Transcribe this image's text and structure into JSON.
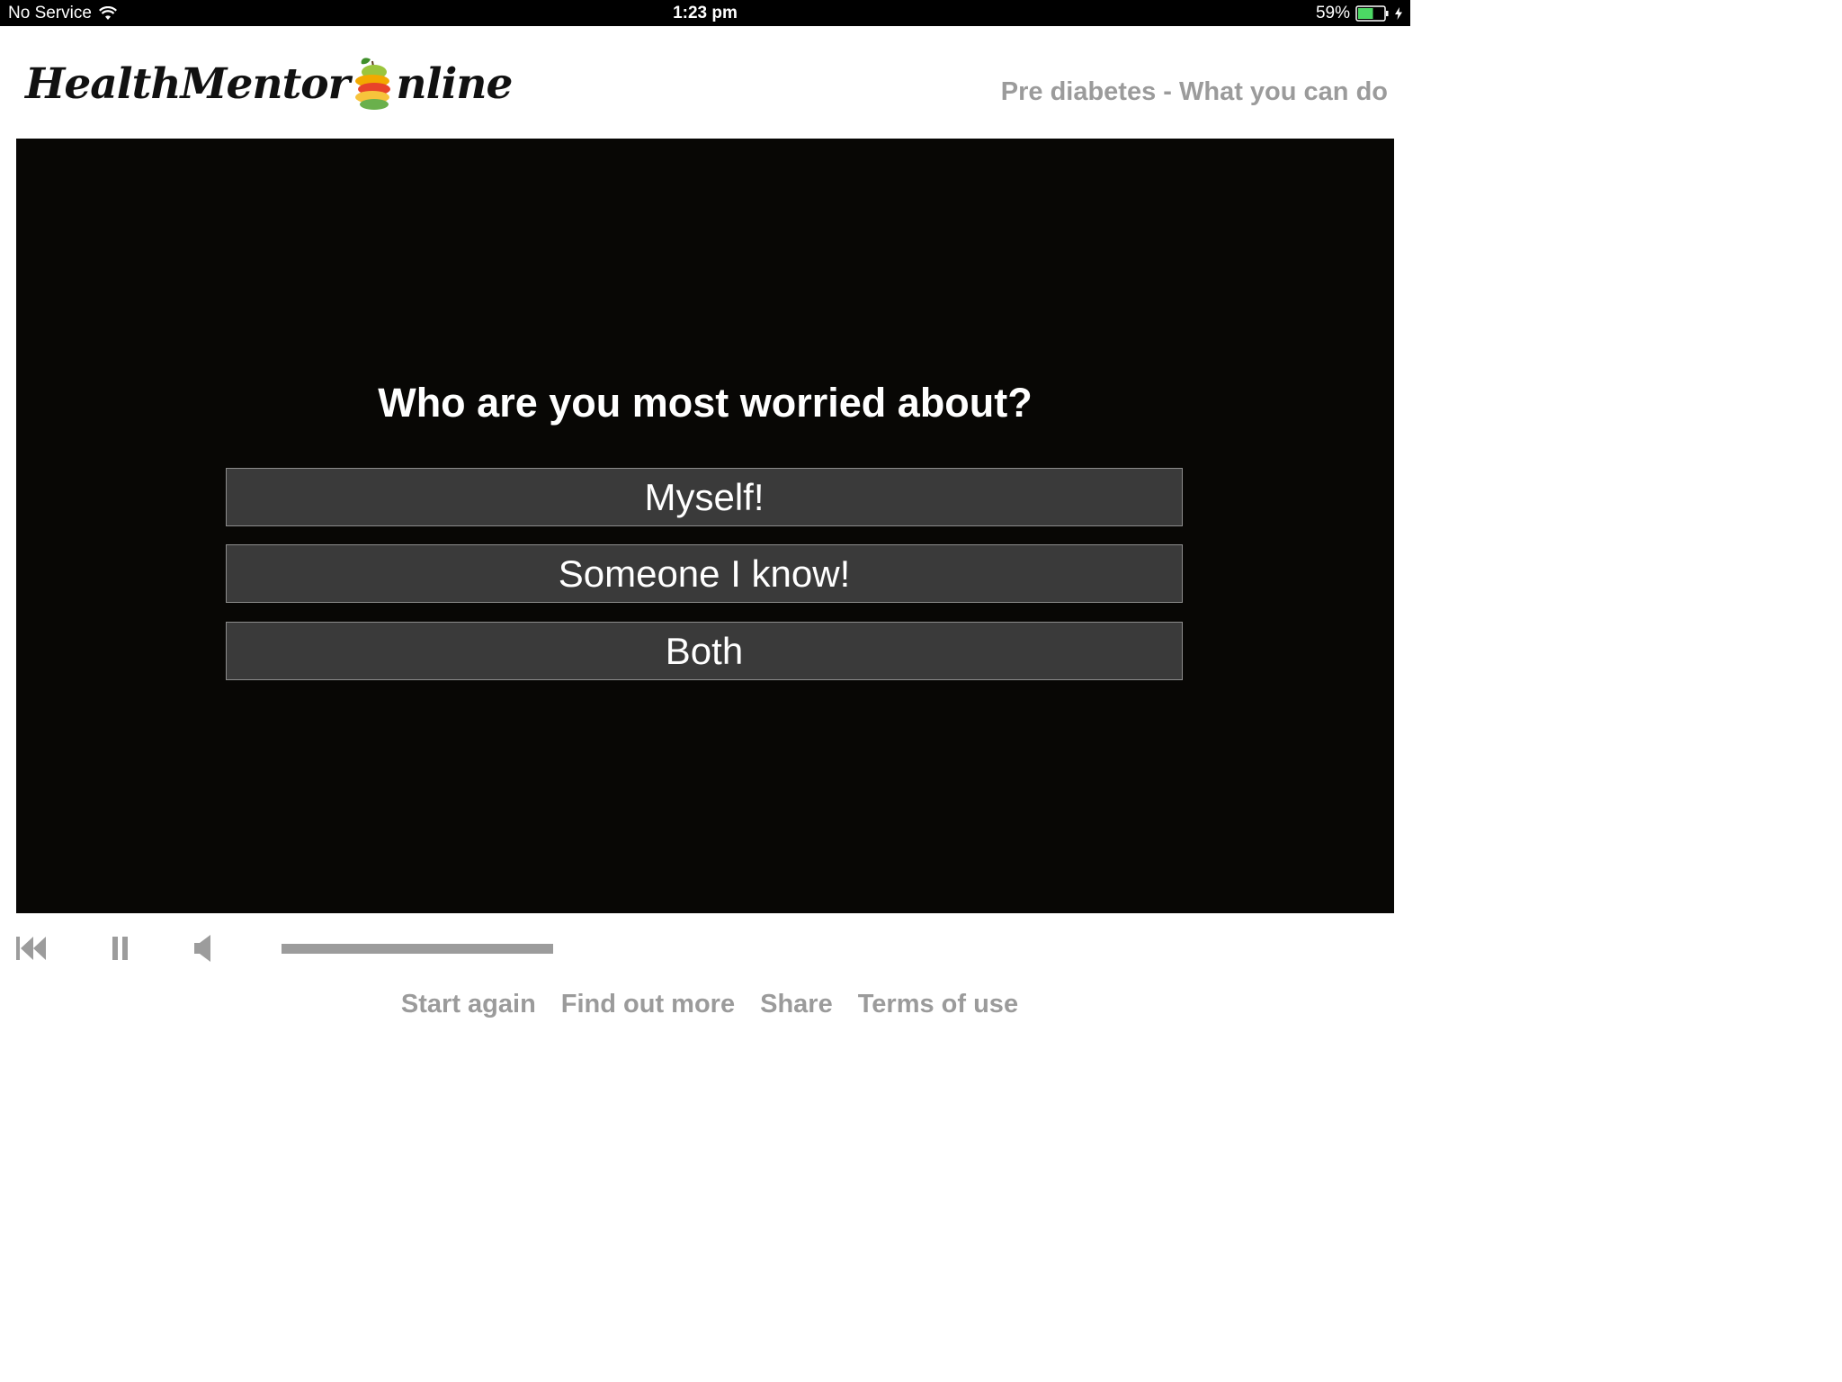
{
  "status_bar": {
    "carrier": "No Service",
    "time": "1:23 pm",
    "battery_percent": "59%",
    "battery_level": 0.59
  },
  "header": {
    "logo_text_left": "HealthMentor",
    "logo_text_right": "nline",
    "subtitle": "Pre diabetes - What you can do"
  },
  "stage": {
    "question": "Who are you most worried about?",
    "answers": [
      "Myself!",
      "Someone I know!",
      "Both"
    ]
  },
  "player": {
    "progress": 1.0
  },
  "footer": {
    "links": [
      "Start again",
      "Find out more",
      "Share",
      "Terms of use"
    ]
  },
  "colors": {
    "stage_bg": "#080705",
    "answer_bg": "#3a3a3a",
    "muted_text": "#9b9b9b",
    "battery_green": "#4cd964"
  }
}
